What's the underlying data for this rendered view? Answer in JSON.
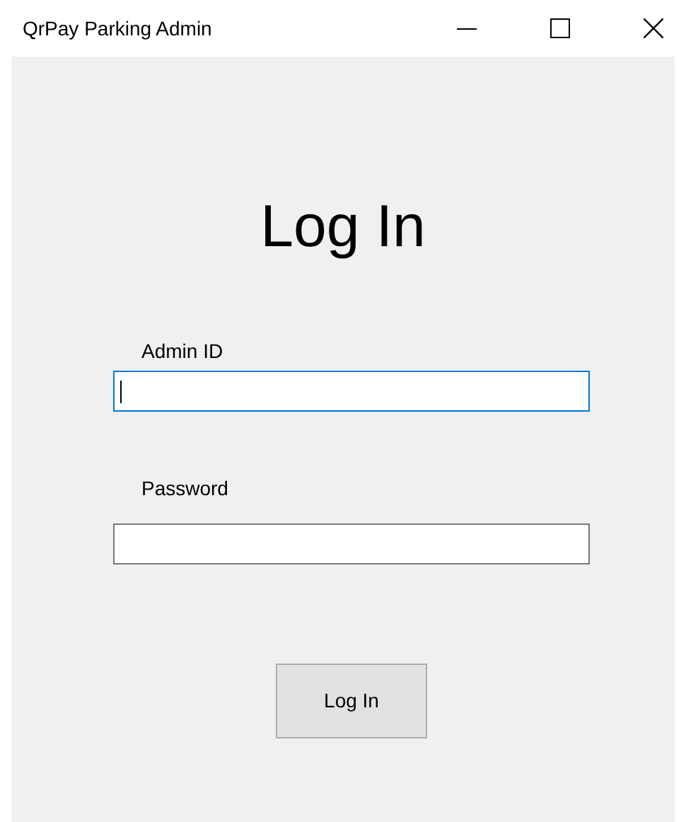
{
  "window": {
    "title": "QrPay Parking Admin"
  },
  "heading": "Log In",
  "fields": [
    {
      "label": "Admin ID",
      "focused": true
    },
    {
      "label": "Password",
      "focused": false
    }
  ],
  "button": "Log In"
}
